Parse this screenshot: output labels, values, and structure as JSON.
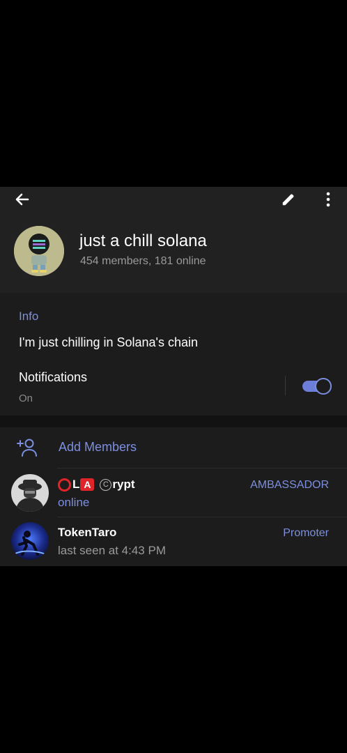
{
  "header": {
    "title": "just a chill solana",
    "subtitle": "454 members, 181 online",
    "icons": {
      "back": "arrow-left-icon",
      "edit": "pencil-icon",
      "more": "more-vertical-icon"
    }
  },
  "info": {
    "label": "Info",
    "text": "I'm just chilling in Solana's chain"
  },
  "notifications": {
    "label": "Notifications",
    "status": "On",
    "enabled": true
  },
  "members": {
    "add_label": "Add Members",
    "list": [
      {
        "name_parts": {
          "o": "",
          "l": "L",
          "a": "A",
          "c": "C",
          "rest": "rypt"
        },
        "status": "online",
        "role": "AMBASSADOR"
      },
      {
        "name": "TokenTaro",
        "status": "last seen at 4:43 PM",
        "role": "Promoter"
      }
    ]
  },
  "colors": {
    "accent": "#7c8fe0",
    "header_bg": "#212121",
    "section_bg": "#1c1c1c",
    "secondary_text": "#9a9a9a",
    "emoji_red": "#e0252a"
  }
}
